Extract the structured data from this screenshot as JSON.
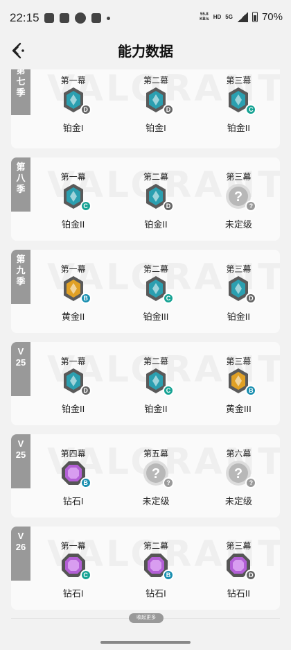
{
  "statusbar": {
    "time": "22:15",
    "speed": "55.8",
    "speed_unit": "KB/s",
    "net1": "HD",
    "net2": "5G",
    "battery": "70%"
  },
  "header": {
    "title": "能力数据"
  },
  "colors": {
    "diamond": "#b35fd6",
    "platinum": "#2b9fb0",
    "gold": "#e0a025",
    "unranked": "#c9c9c9",
    "grade_C": "#17a394",
    "grade_B": "#1a8fb0",
    "grade_D": "#666666"
  },
  "seasons": [
    {
      "tag": [
        "第",
        "七",
        "季"
      ],
      "acts": [
        {
          "act": "第一幕",
          "rank": "铂金I",
          "tier": "platinum",
          "grade": "D"
        },
        {
          "act": "第二幕",
          "rank": "铂金I",
          "tier": "platinum",
          "grade": "D"
        },
        {
          "act": "第三幕",
          "rank": "铂金II",
          "tier": "platinum",
          "grade": "C"
        }
      ]
    },
    {
      "tag": [
        "第",
        "八",
        "季"
      ],
      "acts": [
        {
          "act": "第一幕",
          "rank": "铂金II",
          "tier": "platinum",
          "grade": "C"
        },
        {
          "act": "第二幕",
          "rank": "铂金II",
          "tier": "platinum",
          "grade": "D"
        },
        {
          "act": "第三幕",
          "rank": "未定级",
          "tier": "unranked",
          "grade": "?"
        }
      ]
    },
    {
      "tag": [
        "第",
        "九",
        "季"
      ],
      "acts": [
        {
          "act": "第一幕",
          "rank": "黄金II",
          "tier": "gold",
          "grade": "B"
        },
        {
          "act": "第二幕",
          "rank": "铂金III",
          "tier": "platinum",
          "grade": "C"
        },
        {
          "act": "第三幕",
          "rank": "铂金II",
          "tier": "platinum",
          "grade": "D"
        }
      ]
    },
    {
      "tag": [
        "V",
        "25"
      ],
      "acts": [
        {
          "act": "第一幕",
          "rank": "铂金II",
          "tier": "platinum",
          "grade": "D"
        },
        {
          "act": "第二幕",
          "rank": "铂金II",
          "tier": "platinum",
          "grade": "C"
        },
        {
          "act": "第三幕",
          "rank": "黄金III",
          "tier": "gold",
          "grade": "B"
        }
      ]
    },
    {
      "tag": [
        "V",
        "25"
      ],
      "acts": [
        {
          "act": "第四幕",
          "rank": "钻石I",
          "tier": "diamond",
          "grade": "B"
        },
        {
          "act": "第五幕",
          "rank": "未定级",
          "tier": "unranked",
          "grade": "?"
        },
        {
          "act": "第六幕",
          "rank": "未定级",
          "tier": "unranked",
          "grade": "?"
        }
      ]
    },
    {
      "tag": [
        "V",
        "26"
      ],
      "acts": [
        {
          "act": "第一幕",
          "rank": "钻石I",
          "tier": "diamond",
          "grade": "C"
        },
        {
          "act": "第二幕",
          "rank": "钻石I",
          "tier": "diamond",
          "grade": "B"
        },
        {
          "act": "第三幕",
          "rank": "钻石II",
          "tier": "diamond",
          "grade": "D"
        }
      ]
    }
  ],
  "watermark": "VALORANT",
  "collapse_label": "收起更多"
}
